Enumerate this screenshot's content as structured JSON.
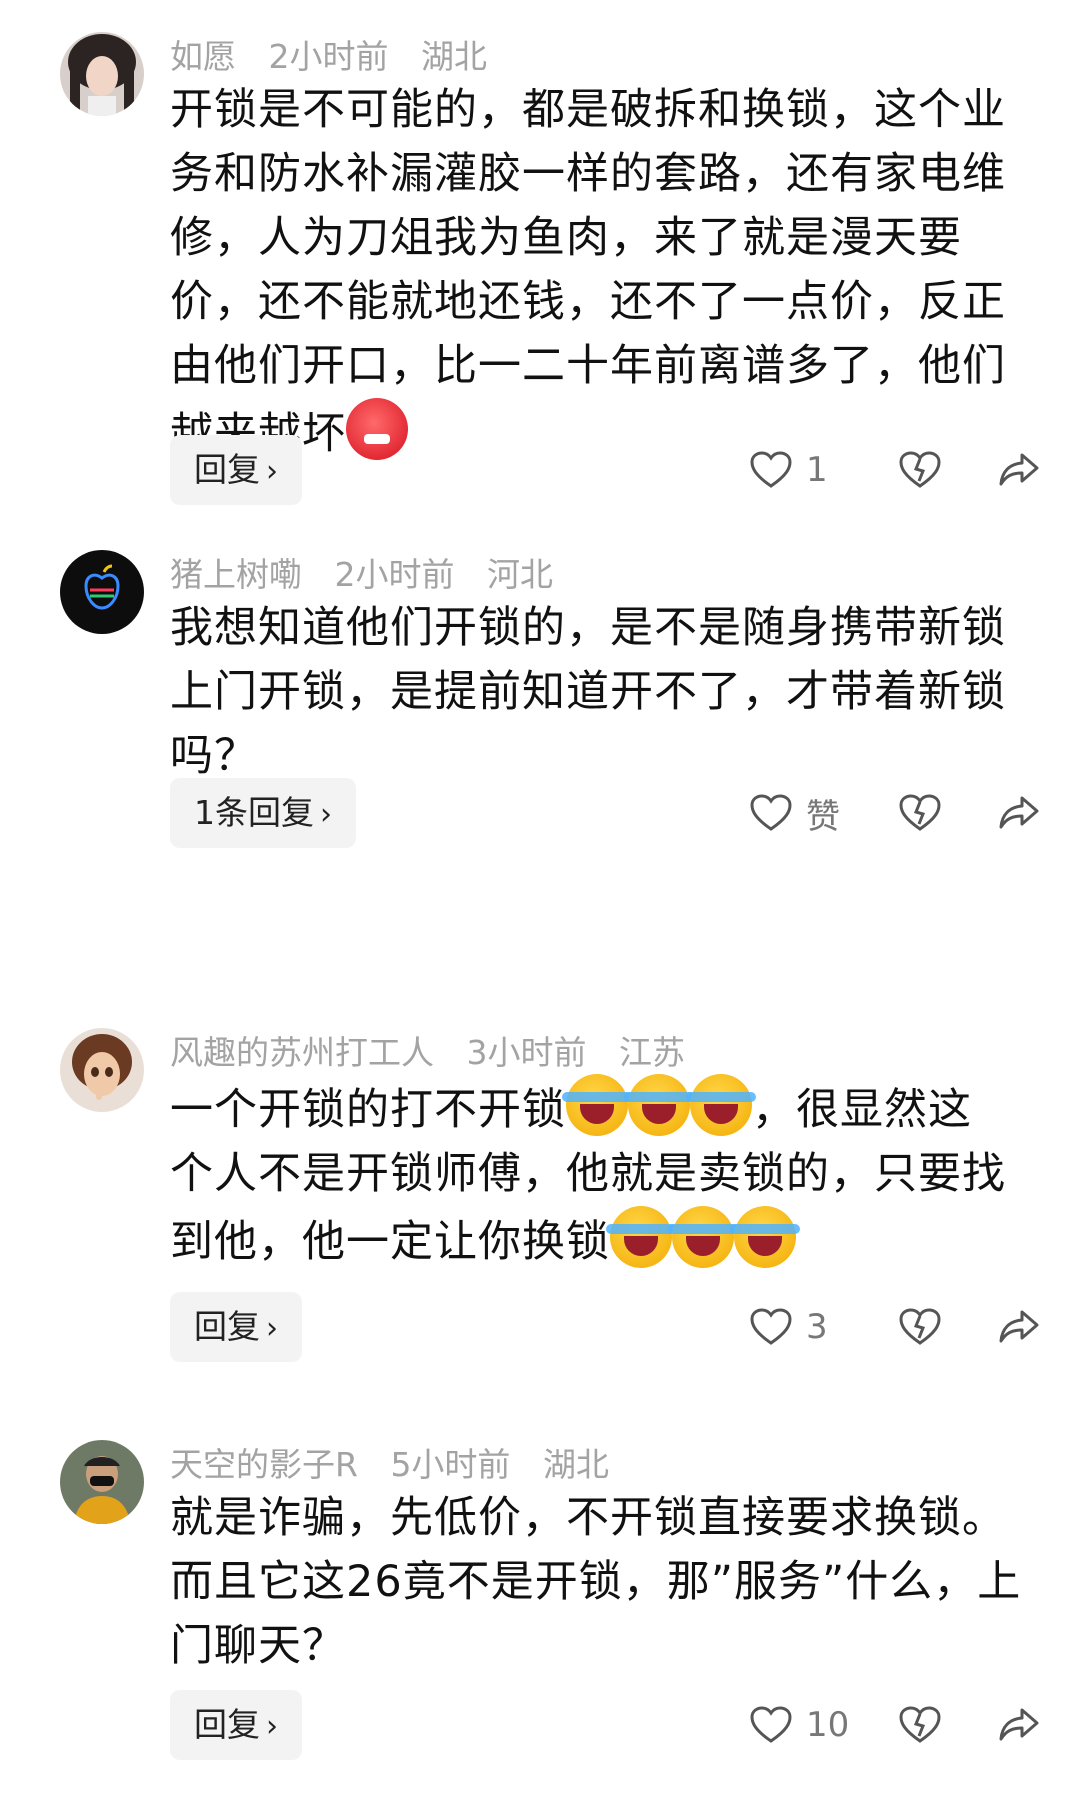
{
  "comments": [
    {
      "username": "如愿",
      "time": "2小时前",
      "location": "湖北",
      "text": "开锁是不可能的，都是破拆和换锁，这个业务和防水补漏灌胶一样的套路，还有家电维修，人为刀俎我为鱼肉，来了就是漫天要价，还不能就地还钱，还不了一点价，反正由他们开口，比一二十年前离谱多了，他们越来越坏",
      "reply_label": "回复",
      "like_count": "1"
    },
    {
      "username": "猪上树嘞",
      "time": "2小时前",
      "location": "河北",
      "text": "我想知道他们开锁的，是不是随身携带新锁上门开锁，是提前知道开不了，才带着新锁吗？",
      "reply_label": "1条回复",
      "like_count": "赞"
    },
    {
      "username": "风趣的苏州打工人",
      "time": "3小时前",
      "location": "江苏",
      "text_a": "一个开锁的打不开锁",
      "text_b": "，很显然这个人不是开锁师傅，他就是卖锁的，只要找到他，他一定让你换锁",
      "reply_label": "回复",
      "like_count": "3"
    },
    {
      "username": "天空的影子R",
      "time": "5小时前",
      "location": "湖北",
      "text": "就是诈骗，先低价，不开锁直接要求换锁。而且它这26竟不是开锁，那”服务”什么，上门聊天？",
      "reply_label": "回复",
      "like_count": "10"
    }
  ],
  "icons": {
    "emoji_angry": "angry-face-emoji",
    "emoji_cry": "crying-laughing-emoji",
    "like": "heart-outline-icon",
    "dislike": "broken-heart-icon",
    "share": "share-arrow-icon",
    "chevron": "chevron-right-icon"
  }
}
